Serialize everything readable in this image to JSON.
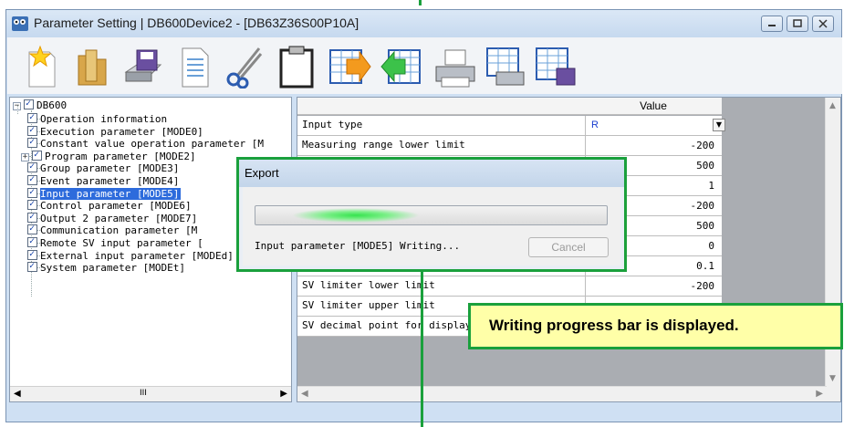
{
  "window": {
    "title": "Parameter Setting  | DB600Device2 - [DB63Z36S00P10A]"
  },
  "toolbar": {
    "buttons": [
      "new-icon",
      "open-icon",
      "save-icon",
      "document-icon",
      "cut-icon",
      "clipboard-icon",
      "export-icon",
      "import-icon",
      "print-icon",
      "print-preview-icon",
      "save-table-icon"
    ]
  },
  "tree": {
    "root": "DB600",
    "items": [
      "Operation information",
      "Execution parameter [MODE0]",
      "Constant value operation parameter [M",
      "Program parameter [MODE2]",
      "Group parameter [MODE3]",
      "Event parameter [MODE4]",
      "Input parameter [MODE5]",
      "Control parameter [MODE6]",
      "Output 2 parameter [MODE7]",
      "Communication parameter [M",
      "Remote SV input parameter [",
      "External input parameter [MODEd]",
      "System parameter [MODEt]"
    ],
    "selected_index": 6,
    "hscroll_mark": "III"
  },
  "grid": {
    "value_header": "Value",
    "rows": [
      {
        "name": "Input type",
        "value": "R"
      },
      {
        "name": "Measuring range lower limit",
        "value": "-200"
      },
      {
        "name": "",
        "value": "500"
      },
      {
        "name": "",
        "value": "1"
      },
      {
        "name": "",
        "value": "-200"
      },
      {
        "name": "",
        "value": "500"
      },
      {
        "name": "",
        "value": "0"
      },
      {
        "name": "",
        "value": "0.1"
      },
      {
        "name": "SV limiter lower limit",
        "value": "-200"
      },
      {
        "name": "SV limiter upper limit",
        "value": ""
      },
      {
        "name": "SV decimal point for display",
        "value": ""
      }
    ]
  },
  "dialog": {
    "title": "Export",
    "status": "Input parameter [MODE5] Writing...",
    "cancel_label": "Cancel",
    "progress": "indeterminate"
  },
  "callout": {
    "text": "Writing progress bar is displayed."
  },
  "colors": {
    "accent_green": "#1aa03c",
    "selection": "#2d6bdc",
    "callout_bg": "#ffffa8"
  }
}
